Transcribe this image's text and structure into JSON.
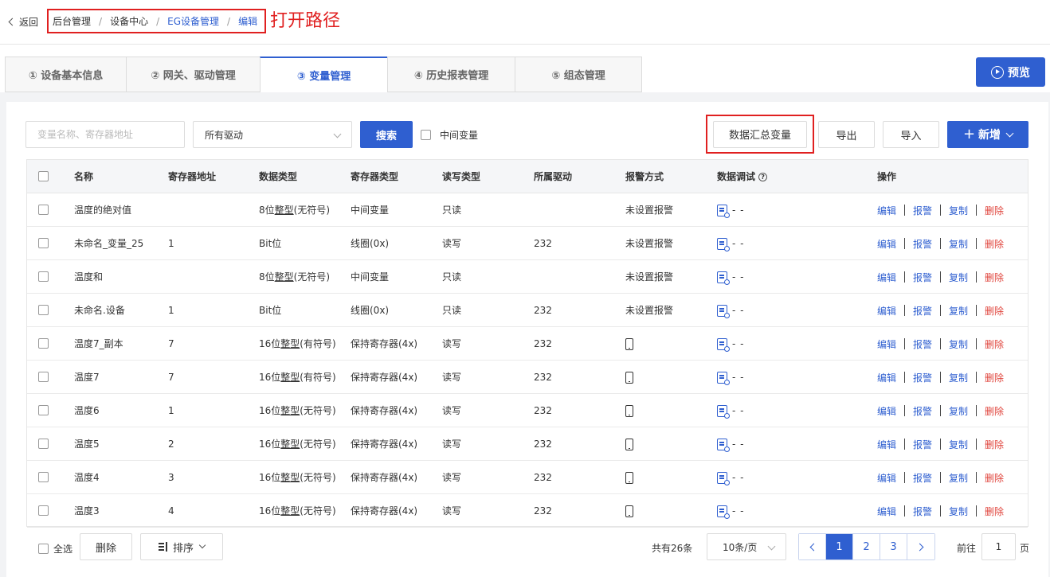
{
  "header": {
    "back_label": "返回",
    "breadcrumb": [
      "后台管理",
      "设备中心",
      "EG设备管理",
      "编辑"
    ],
    "annotation": "打开路径"
  },
  "tabs": [
    {
      "label": "① 设备基本信息",
      "active": false
    },
    {
      "label": "② 网关、驱动管理",
      "active": false
    },
    {
      "label": "③ 变量管理",
      "active": true
    },
    {
      "label": "④ 历史报表管理",
      "active": false
    },
    {
      "label": "⑤ 组态管理",
      "active": false
    }
  ],
  "preview_label": "预览",
  "toolbar": {
    "search_placeholder": "变量名称、寄存器地址",
    "driver_select": "所有驱动",
    "search_label": "搜索",
    "mid_var_label": "中间变量",
    "summary_label": "数据汇总变量",
    "export_label": "导出",
    "import_label": "导入",
    "add_label": "新增"
  },
  "table": {
    "columns": [
      "名称",
      "寄存器地址",
      "数据类型",
      "寄存器类型",
      "读写类型",
      "所属驱动",
      "报警方式",
      "数据调试",
      "操作"
    ],
    "rows": [
      {
        "name": "温度的绝对值",
        "addr": "",
        "dtype_pre": "8位",
        "dtype_u": "整型",
        "dtype_post": "(无符号)",
        "reg": "中间变量",
        "rw": "只读",
        "driver": "",
        "alarm": "未设置报警",
        "alarm_icon": false,
        "debug": "- -"
      },
      {
        "name": "未命名_变量_25",
        "addr": "1",
        "dtype_pre": "Bit位",
        "dtype_u": "",
        "dtype_post": "",
        "reg": "线圈(0x)",
        "rw": "读写",
        "driver": "232",
        "alarm": "未设置报警",
        "alarm_icon": false,
        "debug": "- -"
      },
      {
        "name": "温度和",
        "addr": "",
        "dtype_pre": "8位",
        "dtype_u": "整型",
        "dtype_post": "(无符号)",
        "reg": "中间变量",
        "rw": "只读",
        "driver": "",
        "alarm": "未设置报警",
        "alarm_icon": false,
        "debug": "- -"
      },
      {
        "name": "未命名.设备",
        "addr": "1",
        "dtype_pre": "Bit位",
        "dtype_u": "",
        "dtype_post": "",
        "reg": "线圈(0x)",
        "rw": "只读",
        "driver": "232",
        "alarm": "未设置报警",
        "alarm_icon": false,
        "debug": "- -"
      },
      {
        "name": "温度7_副本",
        "addr": "7",
        "dtype_pre": "16位",
        "dtype_u": "整型",
        "dtype_post": "(有符号)",
        "reg": "保持寄存器(4x)",
        "rw": "读写",
        "driver": "232",
        "alarm": "",
        "alarm_icon": true,
        "debug": "- -"
      },
      {
        "name": "温度7",
        "addr": "7",
        "dtype_pre": "16位",
        "dtype_u": "整型",
        "dtype_post": "(有符号)",
        "reg": "保持寄存器(4x)",
        "rw": "读写",
        "driver": "232",
        "alarm": "",
        "alarm_icon": true,
        "debug": "- -"
      },
      {
        "name": "温度6",
        "addr": "1",
        "dtype_pre": "16位",
        "dtype_u": "整型",
        "dtype_post": "(无符号)",
        "reg": "保持寄存器(4x)",
        "rw": "读写",
        "driver": "232",
        "alarm": "",
        "alarm_icon": true,
        "debug": "- -"
      },
      {
        "name": "温度5",
        "addr": "2",
        "dtype_pre": "16位",
        "dtype_u": "整型",
        "dtype_post": "(无符号)",
        "reg": "保持寄存器(4x)",
        "rw": "读写",
        "driver": "232",
        "alarm": "",
        "alarm_icon": true,
        "debug": "- -"
      },
      {
        "name": "温度4",
        "addr": "3",
        "dtype_pre": "16位",
        "dtype_u": "整型",
        "dtype_post": "(无符号)",
        "reg": "保持寄存器(4x)",
        "rw": "读写",
        "driver": "232",
        "alarm": "",
        "alarm_icon": true,
        "debug": "- -"
      },
      {
        "name": "温度3",
        "addr": "4",
        "dtype_pre": "16位",
        "dtype_u": "整型",
        "dtype_post": "(无符号)",
        "reg": "保持寄存器(4x)",
        "rw": "读写",
        "driver": "232",
        "alarm": "",
        "alarm_icon": true,
        "debug": "- -"
      }
    ],
    "ops": {
      "edit": "编辑",
      "alarm": "报警",
      "copy": "复制",
      "delete": "删除"
    }
  },
  "footer": {
    "select_all": "全选",
    "delete_label": "删除",
    "sort_label": "排序",
    "total_prefix": "共有",
    "total_count": "26",
    "total_suffix": "条",
    "page_size": "10条/页",
    "pages": [
      "1",
      "2",
      "3"
    ],
    "current_page": "1",
    "goto_prefix": "前往",
    "goto_value": "1",
    "goto_suffix": "页"
  },
  "colors": {
    "primary": "#2f5fd0",
    "danger": "#e0443c",
    "highlight": "#e02020"
  }
}
